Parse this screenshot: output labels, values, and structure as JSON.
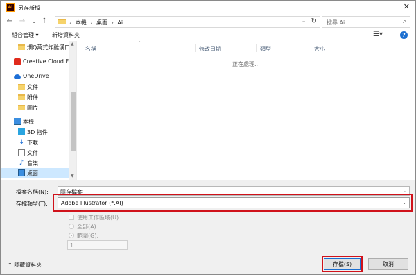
{
  "window": {
    "title": "另存新檔",
    "app_icon_text": "Ai"
  },
  "address": {
    "breadcrumbs": [
      "本機",
      "桌面",
      "Ai"
    ],
    "separator": "›"
  },
  "search": {
    "placeholder": "搜尋 Ai"
  },
  "toolbar": {
    "organize": "組合管理 ▾",
    "new_folder": "新增資料夾"
  },
  "nav_pane": {
    "items": [
      {
        "label": "爛Q萬式炸雞漢口門",
        "icon": "folder-icon"
      },
      {
        "label": "Creative Cloud Files",
        "icon": "creative-cloud-icon"
      },
      {
        "label": "OneDrive",
        "icon": "onedrive-icon"
      },
      {
        "label": "文件",
        "icon": "folder-icon"
      },
      {
        "label": "附件",
        "icon": "folder-icon"
      },
      {
        "label": "圖片",
        "icon": "folder-icon"
      },
      {
        "label": "本機",
        "icon": "computer-icon"
      },
      {
        "label": "3D 物件",
        "icon": "3d-objects-icon"
      },
      {
        "label": "下載",
        "icon": "download-icon"
      },
      {
        "label": "文件",
        "icon": "document-icon"
      },
      {
        "label": "音樂",
        "icon": "music-icon"
      },
      {
        "label": "桌面",
        "icon": "desktop-icon",
        "selected": true
      }
    ]
  },
  "file_list": {
    "columns": [
      "名稱",
      "修改日期",
      "類型",
      "大小"
    ],
    "status": "正在處理..."
  },
  "form": {
    "filename_label": "檔案名稱(N):",
    "filename_value": "隱存檔案",
    "filetype_label": "存檔類型(T):",
    "filetype_value": "Adobe Illustrator (*.AI)",
    "use_artboards": "使用工作區域(U)",
    "all_label": "全部(A)",
    "range_label": "範圍(G):",
    "range_value": "1",
    "hide_folders": "隱藏資料夾",
    "save_button": "存檔(S)",
    "cancel_button": "取消"
  },
  "colors": {
    "highlight": "#d0121b",
    "selection": "#cde8ff",
    "accent": "#1c6fd0"
  }
}
